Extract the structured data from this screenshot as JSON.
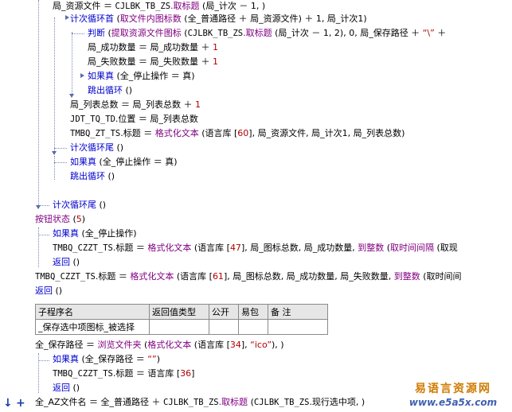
{
  "lines": [
    {
      "name": "line-resource-file",
      "tokens": [
        {
          "t": "局_资源文件 ＝ ",
          "c": "blk"
        },
        {
          "t": "CJLBK_TB_ZS",
          "c": "blk mono"
        },
        {
          "t": ".取标题",
          "c": "purple"
        },
        {
          "t": " (局_计次 － 1, )",
          "c": "blk"
        }
      ]
    },
    {
      "name": "line-for-loop-start",
      "tokens": [
        {
          "t": "计次循环首",
          "c": "blue"
        },
        {
          "t": " (",
          "c": "blk"
        },
        {
          "t": "取文件内图标数",
          "c": "purple"
        },
        {
          "t": " (全_普通路径 ＋ 局_资源文件) ＋ 1, 局_计次1)",
          "c": "blk"
        }
      ]
    },
    {
      "name": "line-if-extract-icon",
      "tokens": [
        {
          "t": "判断",
          "c": "blue"
        },
        {
          "t": " (",
          "c": "blk"
        },
        {
          "t": "提取资源文件图标",
          "c": "purple"
        },
        {
          "t": " (",
          "c": "blk"
        },
        {
          "t": "CJLBK_TB_ZS",
          "c": "blk mono"
        },
        {
          "t": ".取标题",
          "c": "purple"
        },
        {
          "t": " (局_计次 － 1, 2), 0, 局_保存路径 ＋ ",
          "c": "blk"
        },
        {
          "t": "“\\”",
          "c": "red"
        },
        {
          "t": " ＋",
          "c": "blk"
        }
      ]
    },
    {
      "name": "line-success-count",
      "tokens": [
        {
          "t": "局_成功数量 ＝ 局_成功数量 ＋ ",
          "c": "blk"
        },
        {
          "t": "1",
          "c": "red"
        }
      ]
    },
    {
      "name": "line-fail-count",
      "tokens": [
        {
          "t": "局_失败数量 ＝ 局_失败数量 ＋ ",
          "c": "blk"
        },
        {
          "t": "1",
          "c": "red"
        }
      ]
    },
    {
      "name": "line-if-stop",
      "tokens": [
        {
          "t": "如果真",
          "c": "blue"
        },
        {
          "t": " (全_停止操作 ＝ ",
          "c": "blk"
        },
        {
          "t": "真",
          "c": "blk"
        },
        {
          "t": ")",
          "c": "blk"
        }
      ]
    },
    {
      "name": "line-break-inner",
      "tokens": [
        {
          "t": "跳出循环",
          "c": "blue"
        },
        {
          "t": " ()",
          "c": "blk"
        }
      ]
    },
    {
      "name": "line-list-total",
      "tokens": [
        {
          "t": "局_列表总数 ＝ 局_列表总数 ＋ ",
          "c": "blk"
        },
        {
          "t": "1",
          "c": "red"
        }
      ]
    },
    {
      "name": "line-progress-pos",
      "tokens": [
        {
          "t": "JDT_TQ_TD",
          "c": "blk mono"
        },
        {
          "t": ".位置 ＝ 局_列表总数",
          "c": "blk"
        }
      ]
    },
    {
      "name": "line-status-title",
      "tokens": [
        {
          "t": "TMBQ_ZT_TS",
          "c": "blk mono"
        },
        {
          "t": ".标题 ＝ ",
          "c": "blk"
        },
        {
          "t": "格式化文本",
          "c": "purple"
        },
        {
          "t": " (语言库 [",
          "c": "blk"
        },
        {
          "t": "60",
          "c": "red"
        },
        {
          "t": "], 局_资源文件, 局_计次1, 局_列表总数)",
          "c": "blk"
        }
      ]
    },
    {
      "name": "line-for-loop-end-inner",
      "tokens": [
        {
          "t": "计次循环尾",
          "c": "blue"
        },
        {
          "t": " ()",
          "c": "blk"
        }
      ]
    },
    {
      "name": "line-if-stop-2",
      "tokens": [
        {
          "t": "如果真",
          "c": "blue"
        },
        {
          "t": " (全_停止操作 ＝ 真)",
          "c": "blk"
        }
      ]
    },
    {
      "name": "line-break-outer",
      "tokens": [
        {
          "t": "跳出循环",
          "c": "blue"
        },
        {
          "t": " ()",
          "c": "blk"
        }
      ]
    },
    {
      "name": "line-for-loop-end-outer",
      "tokens": [
        {
          "t": "计次循环尾",
          "c": "blue"
        },
        {
          "t": " ()",
          "c": "blk"
        }
      ]
    },
    {
      "name": "line-button-state",
      "tokens": [
        {
          "t": "按钮状态",
          "c": "purple"
        },
        {
          "t": " (",
          "c": "blk"
        },
        {
          "t": "5",
          "c": "red"
        },
        {
          "t": ")",
          "c": "blk"
        }
      ]
    },
    {
      "name": "line-if-stop-op",
      "tokens": [
        {
          "t": "如果真",
          "c": "blue"
        },
        {
          "t": " (全_停止操作)",
          "c": "blk"
        }
      ]
    },
    {
      "name": "line-czzt-title-1",
      "tokens": [
        {
          "t": "TMBQ_CZZT_TS",
          "c": "blk mono"
        },
        {
          "t": ".标题 ＝ ",
          "c": "blk"
        },
        {
          "t": "格式化文本",
          "c": "purple"
        },
        {
          "t": " (语言库 [",
          "c": "blk"
        },
        {
          "t": "47",
          "c": "red"
        },
        {
          "t": "], 局_图标总数, 局_成功数量, ",
          "c": "blk"
        },
        {
          "t": "到整数",
          "c": "purple"
        },
        {
          "t": " (",
          "c": "blk"
        },
        {
          "t": "取时间间隔",
          "c": "purple"
        },
        {
          "t": " (取现",
          "c": "blk"
        }
      ]
    },
    {
      "name": "line-return-1",
      "tokens": [
        {
          "t": "返回",
          "c": "blue"
        },
        {
          "t": " ()",
          "c": "blk"
        }
      ]
    },
    {
      "name": "line-czzt-title-2",
      "tokens": [
        {
          "t": "TMBQ_CZZT_TS",
          "c": "blk mono"
        },
        {
          "t": ".标题 ＝ ",
          "c": "blk"
        },
        {
          "t": "格式化文本",
          "c": "purple"
        },
        {
          "t": " (语言库 [",
          "c": "blk"
        },
        {
          "t": "61",
          "c": "red"
        },
        {
          "t": "], 局_图标总数, 局_成功数量, 局_失败数量, ",
          "c": "blk"
        },
        {
          "t": "到整数",
          "c": "purple"
        },
        {
          "t": " (取时间间",
          "c": "blk"
        }
      ]
    },
    {
      "name": "line-return-2",
      "tokens": [
        {
          "t": "返回",
          "c": "blue"
        },
        {
          "t": " ()",
          "c": "blk"
        }
      ]
    },
    {
      "name": "line-save-path",
      "tokens": [
        {
          "t": "全_保存路径 ＝ ",
          "c": "blk"
        },
        {
          "t": "浏览文件夹",
          "c": "purple"
        },
        {
          "t": " (",
          "c": "blk"
        },
        {
          "t": "格式化文本",
          "c": "purple"
        },
        {
          "t": " (语言库 [",
          "c": "blk"
        },
        {
          "t": "34",
          "c": "red"
        },
        {
          "t": "], ",
          "c": "blk"
        },
        {
          "t": "“ico”",
          "c": "red"
        },
        {
          "t": "), )",
          "c": "blk"
        }
      ]
    },
    {
      "name": "line-if-empty-path",
      "tokens": [
        {
          "t": "如果真",
          "c": "blue"
        },
        {
          "t": " (全_保存路径 ＝ ",
          "c": "blk"
        },
        {
          "t": "“”",
          "c": "red"
        },
        {
          "t": ")",
          "c": "blk"
        }
      ]
    },
    {
      "name": "line-czzt-lang",
      "tokens": [
        {
          "t": "TMBQ_CZZT_TS",
          "c": "blk mono"
        },
        {
          "t": ".标题 ＝ 语言库 [",
          "c": "blk"
        },
        {
          "t": "36",
          "c": "red"
        },
        {
          "t": "]",
          "c": "blk"
        }
      ]
    },
    {
      "name": "line-return-3",
      "tokens": [
        {
          "t": "返回",
          "c": "blue"
        },
        {
          "t": " ()",
          "c": "blk"
        }
      ]
    },
    {
      "name": "line-az-filename",
      "tokens": [
        {
          "t": "全_AZ文件名 ＝ 全_普通路径 ＋ ",
          "c": "blk"
        },
        {
          "t": "CJLBK_TB_ZS",
          "c": "blk mono"
        },
        {
          "t": ".取标题",
          "c": "purple"
        },
        {
          "t": " (",
          "c": "blk"
        },
        {
          "t": "CJLBK_TB_ZS",
          "c": "blk mono"
        },
        {
          "t": ".现行选中项, )",
          "c": "blk"
        }
      ]
    }
  ],
  "subtable": {
    "headers": [
      "子程序名",
      "返回值类型",
      "公开",
      "易包",
      "备 注"
    ],
    "row": [
      "_保存选中项图标_被选择",
      "",
      "",
      "",
      ""
    ]
  },
  "markers": {
    "down_arrow": "↓",
    "plus": "+"
  },
  "watermark": {
    "title": "易语言资源网",
    "url": "www.e5a5x.com"
  }
}
